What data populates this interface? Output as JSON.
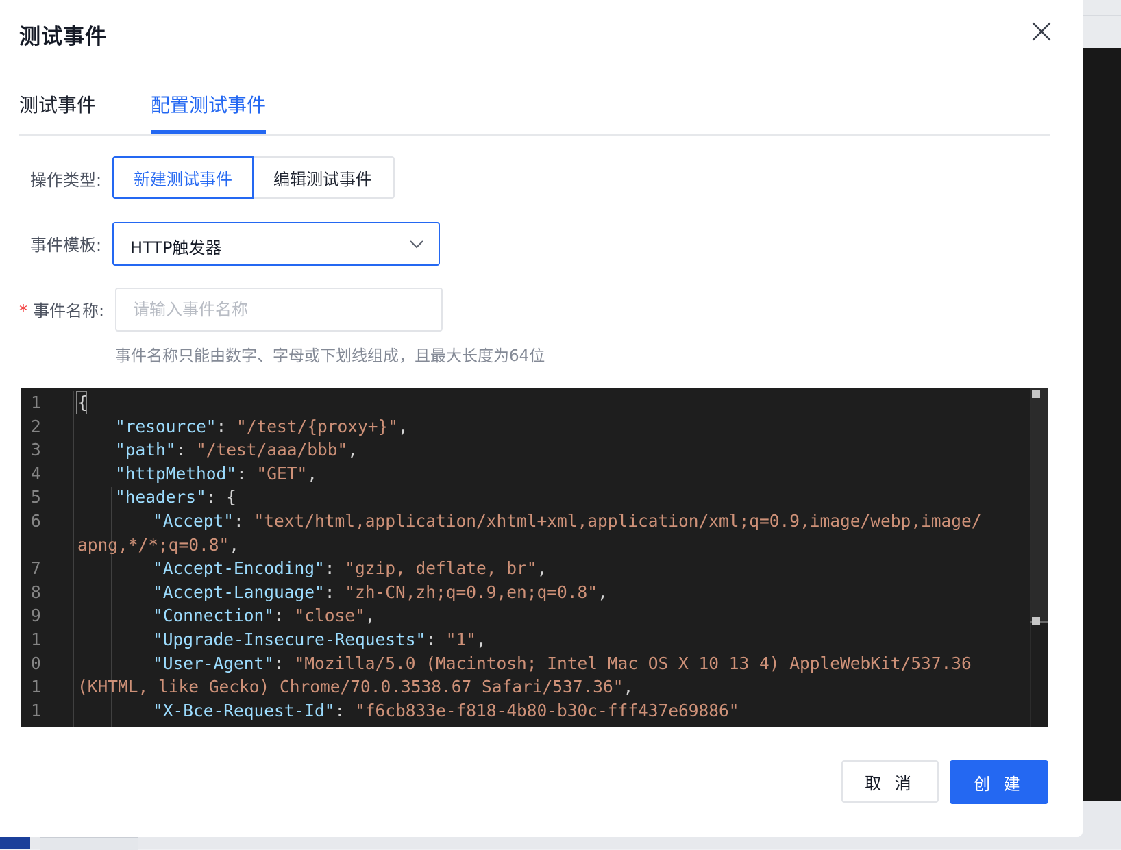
{
  "modal": {
    "title": "测试事件",
    "tabs": [
      {
        "label": "测试事件",
        "active": false
      },
      {
        "label": "配置测试事件",
        "active": true
      }
    ]
  },
  "form": {
    "operation": {
      "label": "操作类型:",
      "options": [
        "新建测试事件",
        "编辑测试事件"
      ],
      "selected": "新建测试事件"
    },
    "template": {
      "label": "事件模板:",
      "value": "HTTP触发器"
    },
    "name": {
      "required_mark": "*",
      "label": "事件名称:",
      "value": "",
      "placeholder": "请输入事件名称",
      "hint": "事件名称只能由数字、字母或下划线组成，且最大长度为64位"
    }
  },
  "editor": {
    "line_numbers": [
      "1",
      "2",
      "3",
      "4",
      "5",
      "6",
      "",
      "7",
      "8",
      "9",
      "1",
      "0",
      "1",
      "1"
    ],
    "lines": [
      [
        "{"
      ],
      [
        "\"resource\"",
        ": ",
        "\"/test/{proxy+}\"",
        ","
      ],
      [
        "\"path\"",
        ": ",
        "\"/test/aaa/bbb\"",
        ","
      ],
      [
        "\"httpMethod\"",
        ": ",
        "\"GET\"",
        ","
      ],
      [
        "\"headers\"",
        ": {"
      ],
      [
        "\"Accept\"",
        ": ",
        "\"text/html,application/xhtml+xml,application/xml;q=0.9,image/webp,image/",
        ""
      ],
      [
        "",
        "",
        "apng,*/*;q=0.8\"",
        ","
      ],
      [
        "\"Accept-Encoding\"",
        ": ",
        "\"gzip, deflate, br\"",
        ","
      ],
      [
        "\"Accept-Language\"",
        ": ",
        "\"zh-CN,zh;q=0.9,en;q=0.8\"",
        ","
      ],
      [
        "\"Connection\"",
        ": ",
        "\"close\"",
        ","
      ],
      [
        "\"Upgrade-Insecure-Requests\"",
        ": ",
        "\"1\"",
        ","
      ],
      [
        "\"User-Agent\"",
        ": ",
        "\"Mozilla/5.0 (Macintosh; Intel Mac OS X 10_13_4) AppleWebKit/537.36",
        ""
      ],
      [
        "",
        "",
        "(KHTML, like Gecko) Chrome/70.0.3538.67 Safari/537.36\"",
        ","
      ],
      [
        "\"X-Bce-Request-Id\"",
        ": ",
        "\"f6cb833e-f818-4b80-b30c-fff437e69886\"",
        ""
      ]
    ]
  },
  "footer": {
    "cancel_label": "取 消",
    "create_label": "创 建"
  },
  "colors": {
    "accent": "#2468f2",
    "editor_bg": "#1e1e1e",
    "json_key": "#9cdcfe",
    "json_string": "#ce9178"
  }
}
